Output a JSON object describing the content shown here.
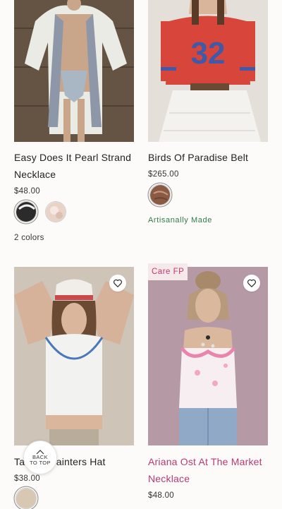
{
  "products": [
    {
      "title": "Easy Does It Pearl Strand Necklace",
      "price": "$48.00",
      "colors_count": "2 colors",
      "swatches": [
        {
          "name": "black",
          "color": "#2b2b2b"
        },
        {
          "name": "ivory",
          "color": "#e9d2c6"
        }
      ]
    },
    {
      "title": "Birds Of Paradise Belt",
      "price": "$265.00",
      "tag": "Artisanally Made",
      "swatches": [
        {
          "name": "brown",
          "color": "#8a5a44"
        }
      ]
    },
    {
      "title": "Painters Hat",
      "title_prefix": "Ta",
      "price": "$38.00",
      "swatches": [
        {
          "name": "tan",
          "color": "#d8c7b2"
        }
      ]
    },
    {
      "badge": "Care FP",
      "title": "Ariana Ost At The Market Necklace",
      "price": "$48.00"
    }
  ],
  "back_to_top": {
    "line1": "BACK",
    "line2": "TO TOP"
  },
  "colors": {
    "artisan_green": "#2f7a4d",
    "care_pink": "#c2376b",
    "title_pink": "#b83a72"
  }
}
